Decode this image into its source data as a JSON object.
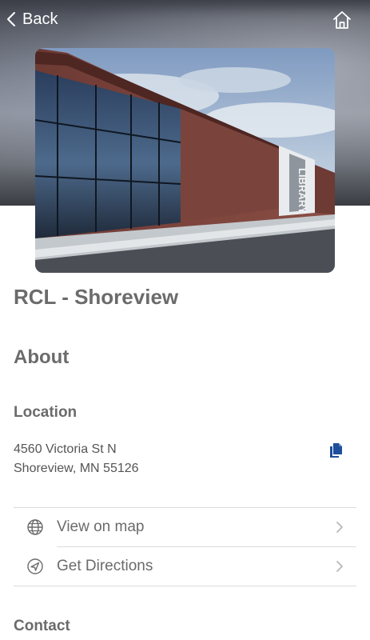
{
  "nav": {
    "back_label": "Back"
  },
  "place": {
    "title": "RCL - Shoreview",
    "photo_signage": "LIBRARY"
  },
  "about": {
    "heading": "About",
    "location_heading": "Location",
    "address_line1": "4560 Victoria St N",
    "address_line2": "Shoreview, MN 55126"
  },
  "actions": [
    {
      "label": "View on map",
      "icon": "globe-icon"
    },
    {
      "label": "Get Directions",
      "icon": "navigation-arrow-icon"
    }
  ],
  "contact": {
    "heading": "Contact"
  },
  "colors": {
    "accent": "#1f4e9c",
    "text": "#6b6b6b",
    "divider": "#dcdcdc"
  }
}
